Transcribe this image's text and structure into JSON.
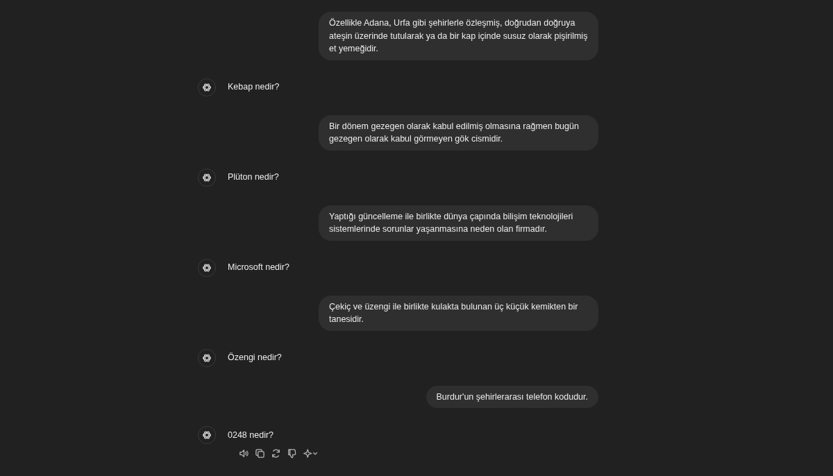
{
  "messages": [
    {
      "kind": "user",
      "text": "Özellikle Adana, Urfa gibi şehirlerle özleşmiş, doğrudan doğruya ateşin üzerinde tutularak ya da bir kap içinde susuz olarak pişirilmiş et yemeğidir."
    },
    {
      "kind": "assistant",
      "text": "Kebap nedir?"
    },
    {
      "kind": "user",
      "text": "Bir dönem gezegen olarak kabul edilmiş olmasına rağmen bugün gezegen olarak kabul görmeyen gök cismidir."
    },
    {
      "kind": "assistant",
      "text": "Plüton nedir?"
    },
    {
      "kind": "user",
      "text": "Yaptığı güncelleme ile birlikte dünya çapında bilişim teknolojileri sistemlerinde sorunlar yaşanmasına neden olan firmadır."
    },
    {
      "kind": "assistant",
      "text": "Microsoft nedir?"
    },
    {
      "kind": "user",
      "text": "Çekiç ve üzengi ile birlikte kulakta bulunan üç küçük kemikten bir tanesidir."
    },
    {
      "kind": "assistant",
      "text": "Özengi nedir?"
    },
    {
      "kind": "user",
      "text": "Burdur'un şehirlerarası telefon kodudur."
    },
    {
      "kind": "assistant",
      "text": "0248 nedir?",
      "show_actions": true
    }
  ]
}
